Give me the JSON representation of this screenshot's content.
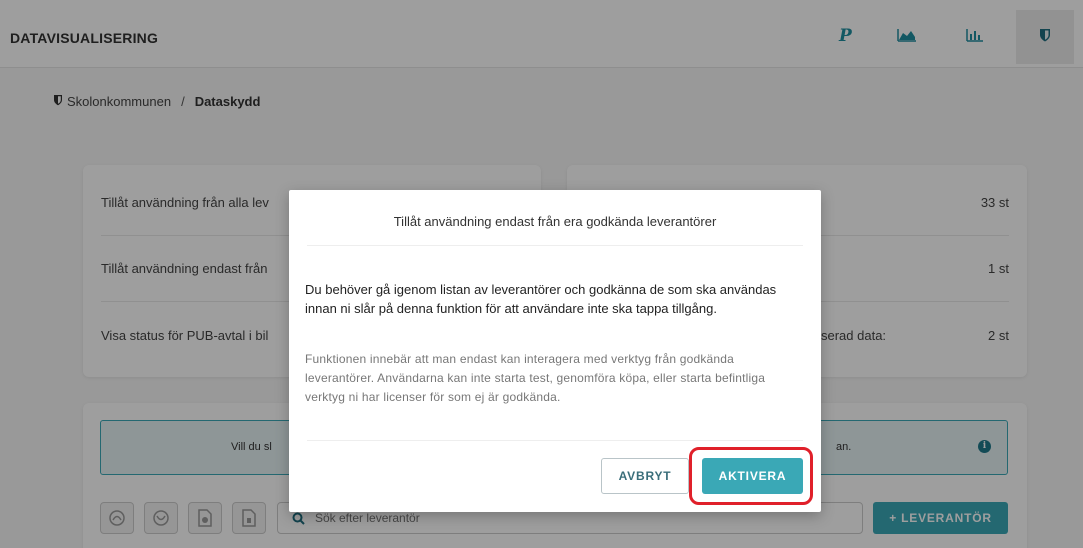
{
  "header": {
    "title": "DATAVISUALISERING",
    "nav_icons": [
      "paragraph-icon",
      "area-chart-icon",
      "bar-chart-icon",
      "shield-icon"
    ]
  },
  "breadcrumb": {
    "root": "Skolonkommunen",
    "separator": "/",
    "current": "Dataskydd"
  },
  "settings_left": {
    "rows": [
      {
        "label": "Tillåt användning från alla lev"
      },
      {
        "label": "Tillåt användning endast från"
      },
      {
        "label": "Visa status för PUB-avtal i bil"
      }
    ]
  },
  "settings_right": {
    "rows": [
      {
        "label": "",
        "value": "33 st"
      },
      {
        "label": "",
        "value": "1 st"
      },
      {
        "label": "serad data:",
        "value": "2 st"
      }
    ]
  },
  "info_box": {
    "left_text": "Vill du sl",
    "right_text": "an."
  },
  "search": {
    "placeholder": "Sök efter leverantör"
  },
  "add_button": "+ LEVERANTÖR",
  "modal": {
    "title": "Tillåt användning endast från era godkända leverantörer",
    "lead": "Du behöver gå igenom listan av leverantörer och godkänna de som ska användas innan ni slår på denna funktion för att användare inte ska tappa tillgång.",
    "description": "Funktionen innebär att man endast kan interagera med verktyg från godkända leverantörer. Användarna kan inte starta test, genomföra köpa, eller starta befintliga verktyg ni har licenser för som ej är godkända.",
    "cancel_label": "AVBRYT",
    "activate_label": "AKTIVERA"
  },
  "colors": {
    "accent": "#3aa8b6",
    "highlight": "#e0202a"
  }
}
